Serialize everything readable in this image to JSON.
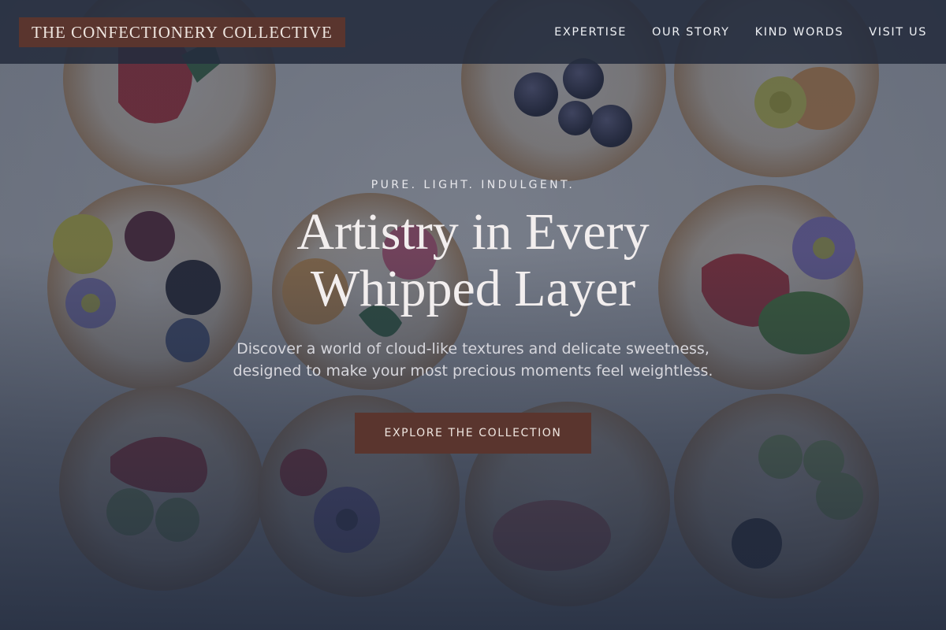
{
  "header": {
    "brand": "THE CONFECTIONERY COLLECTIVE",
    "nav": [
      {
        "label": "EXPERTISE"
      },
      {
        "label": "OUR STORY"
      },
      {
        "label": "KIND WORDS"
      },
      {
        "label": "VISIT US"
      }
    ]
  },
  "hero": {
    "eyebrow": "PURE. LIGHT. INDULGENT.",
    "title_lines": [
      "Artistry in Every",
      "Whipped Layer"
    ],
    "subtitle_lines": [
      "Discover a world of cloud-like textures and delicate sweetness,",
      "designed to make your most precious moments feel weightless."
    ],
    "cta_label": "EXPLORE THE COLLECTION",
    "background_image": "overhead photo of fruit-topped cream tarts with edible flowers"
  },
  "colors": {
    "header_bg": "#242c3e",
    "accent": "#5a352e",
    "overlay": "#2c3446",
    "text_light": "#f2eeee"
  }
}
